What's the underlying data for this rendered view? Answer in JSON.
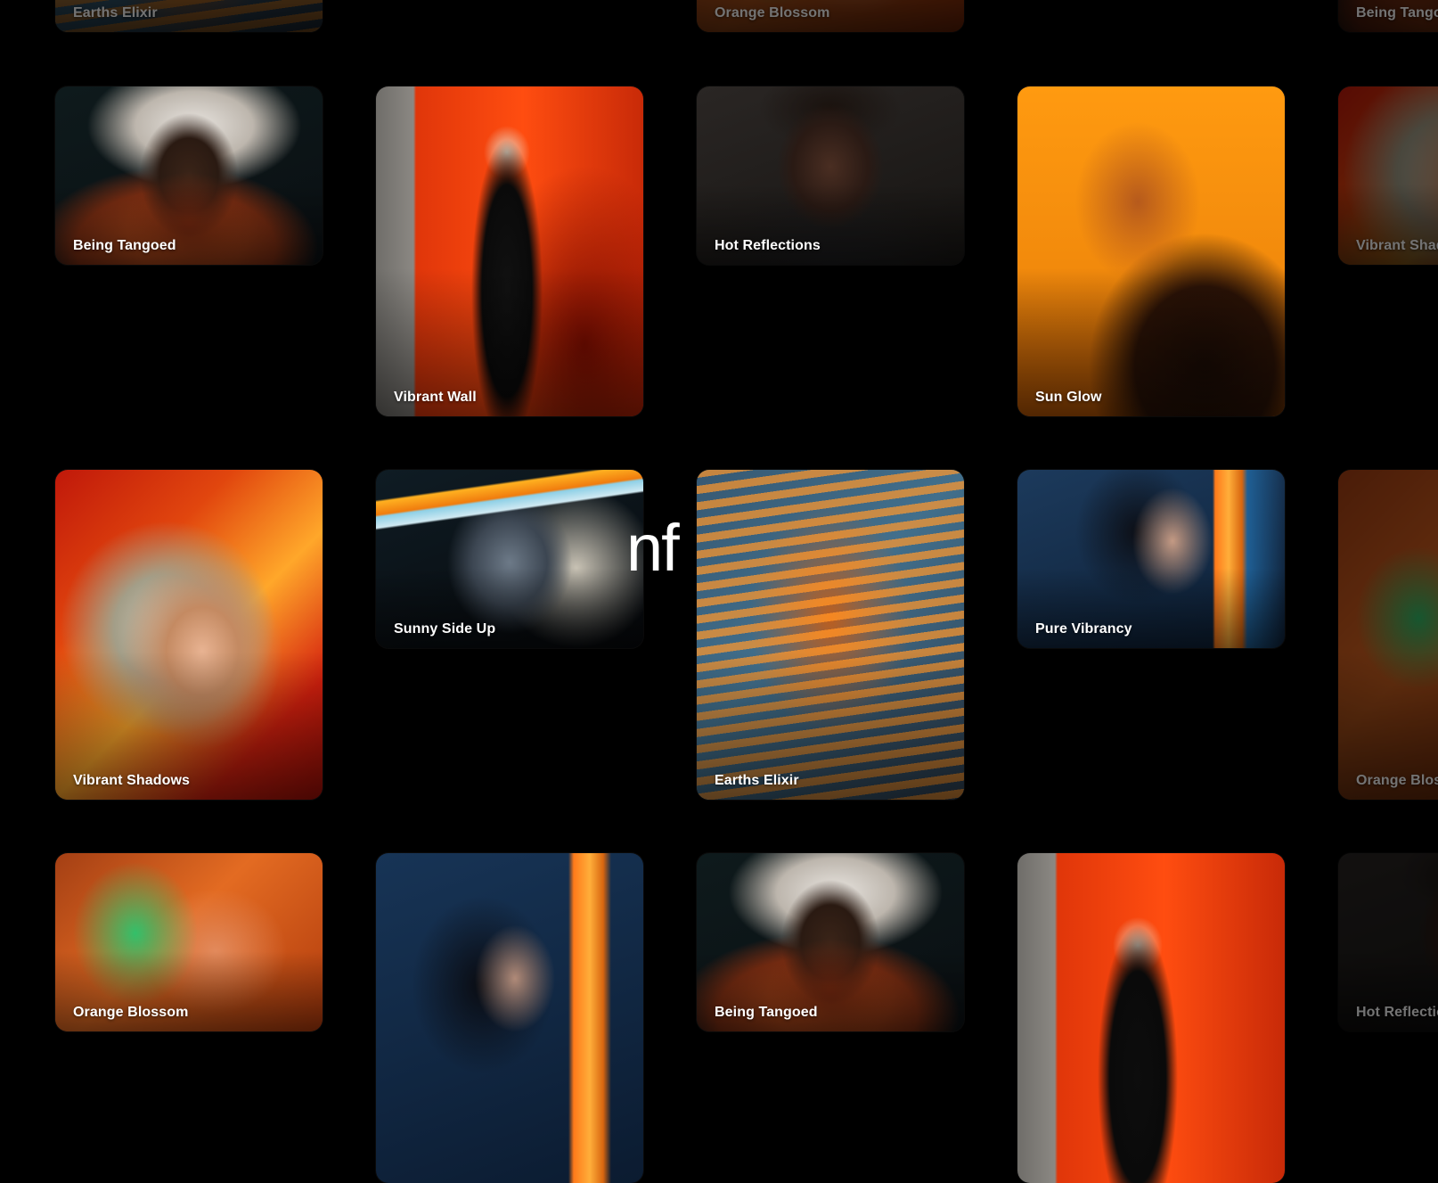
{
  "overlay_text": "nf",
  "cards": {
    "top_earths": "Earths Elixir",
    "top_blossom": "Orange Blossom",
    "top_tangoed": "Being Tango",
    "being_tangoed": "Being Tangoed",
    "vibrant_wall": "Vibrant Wall",
    "hot_reflections": "Hot Reflections",
    "sun_glow": "Sun Glow",
    "vibrant_shadows_edge": "Vibrant Shad",
    "vibrant_shadows": "Vibrant Shadows",
    "sunny_side_up": "Sunny Side Up",
    "earths_elixir": "Earths Elixir",
    "pure_vibrancy": "Pure Vibrancy",
    "orange_blossom_edge": "Orange Bloss",
    "orange_blossom": "Orange Blossom",
    "being_tangoed_2": "Being Tangoed",
    "hot_reflections_edge": "Hot Reflectio"
  }
}
